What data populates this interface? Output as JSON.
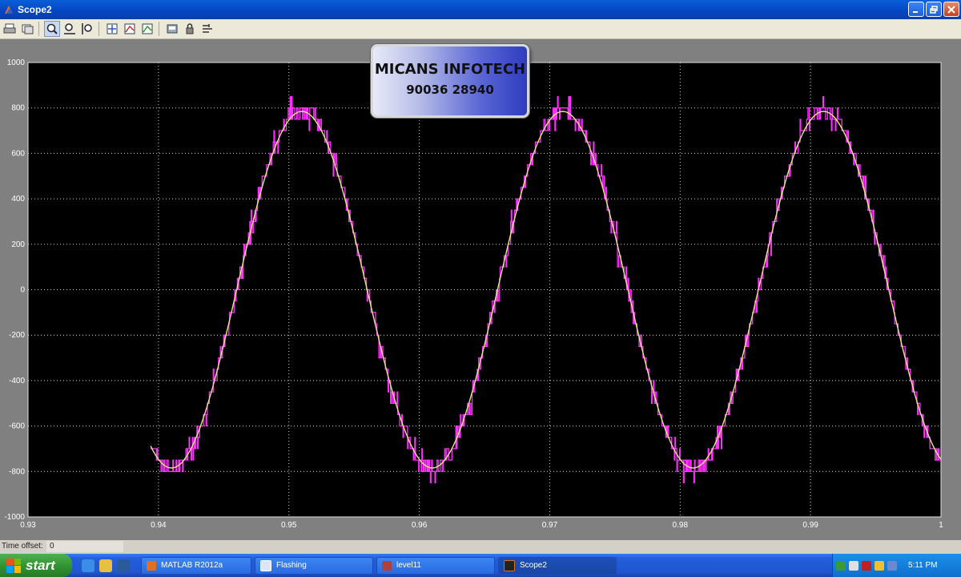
{
  "window": {
    "title": "Scope2",
    "icon": "scope-window-icon"
  },
  "title_buttons": [
    "minimize",
    "maximize",
    "close"
  ],
  "toolbar": {
    "buttons": [
      "print-icon",
      "parameters-icon",
      "zoom-icon",
      "zoom-x-icon",
      "zoom-y-icon",
      "autoscale-icon",
      "save-axes-icon",
      "restore-axes-icon",
      "floating-scope-icon",
      "lock-icon",
      "signal-selection-icon"
    ]
  },
  "watermark": {
    "line1": "MICANS INFOTECH",
    "line2": "90036 28940"
  },
  "chart_data": {
    "type": "line",
    "xlim": [
      0.93,
      1.0
    ],
    "ylim": [
      -1000,
      1000
    ],
    "grid": true,
    "x_ticks": [
      "0.93",
      "0.94",
      "0.95",
      "0.96",
      "0.97",
      "0.98",
      "0.99",
      "1"
    ],
    "y_ticks": [
      "1000",
      "800",
      "600",
      "400",
      "200",
      "0",
      "-200",
      "-400",
      "-600",
      "-800",
      "-1000"
    ],
    "background": "#000000",
    "series": [
      {
        "color": "#e6e68a",
        "style": "sine",
        "x_start": 0.9394,
        "x_end": 1.0,
        "amplitude": 785,
        "frequency_hz": 50,
        "peak_at": 0.951
      },
      {
        "color": "#ff30ff",
        "style": "multilevel-staircase",
        "x_start": 0.9394,
        "x_end": 1.0,
        "amplitude": 790,
        "frequency_hz": 50,
        "peak_at": 0.951,
        "step": 50,
        "max_level": 880
      }
    ]
  },
  "status": {
    "label": "Time offset:",
    "value": "0"
  },
  "taskbar": {
    "start_label": "start",
    "quick_launch": [
      "ie-icon",
      "outlook-icon",
      "media-player-icon"
    ],
    "items": [
      {
        "label": "MATLAB  R2012a",
        "icon": "matlab-icon",
        "active": false
      },
      {
        "label": "Flashing",
        "icon": "simulink-icon",
        "active": false
      },
      {
        "label": "level11",
        "icon": "model-icon",
        "active": false
      },
      {
        "label": "Scope2",
        "icon": "scope-icon",
        "active": true
      }
    ],
    "clock": "5:11 PM"
  }
}
